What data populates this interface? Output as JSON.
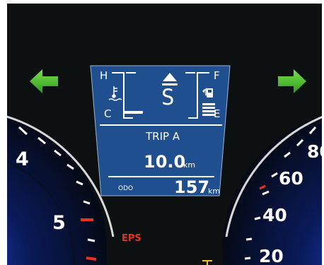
{
  "display": {
    "temp_high": "H",
    "temp_low": "C",
    "fuel_full": "F",
    "fuel_empty": "E",
    "gear": "S",
    "trip_label": "TRIP A",
    "trip_value": "10.0",
    "trip_unit": "km",
    "odo_label": "ODO",
    "odo_value": "157",
    "odo_unit": "km",
    "temp_level": 0.15,
    "fuel_level": 0.3
  },
  "indicators": {
    "turn_left_icon": "arrow-left",
    "turn_right_icon": "arrow-right",
    "eps_label": "EPS"
  },
  "tachometer": {
    "labels": [
      "4",
      "5"
    ]
  },
  "speedometer": {
    "labels": [
      "80",
      "60",
      "40",
      "20"
    ]
  },
  "colors": {
    "panel_background": "#0c1010",
    "display_background": "#1f4f8f",
    "turn_signal": "#3fbf2a",
    "warning_red": "#e8321e"
  }
}
